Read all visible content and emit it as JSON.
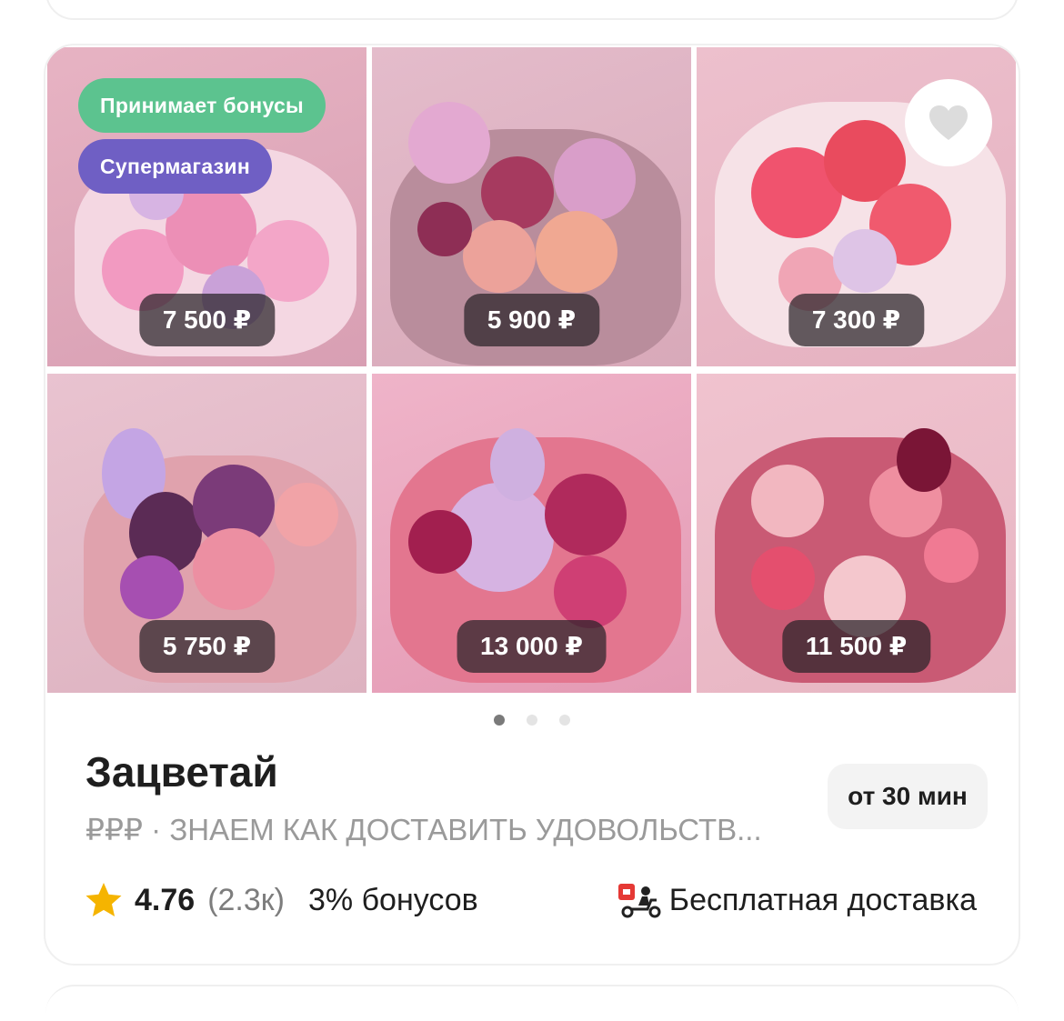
{
  "store": {
    "name": "Зацветай",
    "price_level": "₽₽₽",
    "separator": " · ",
    "tagline": "ЗНАЕМ КАК ДОСТАВИТЬ УДОВОЛЬСТВ...",
    "delivery_time": "от 30 мин",
    "rating": "4.76",
    "rating_count": "(2.3к)",
    "bonus": "3% бонусов",
    "delivery": "Бесплатная доставка"
  },
  "badges": {
    "bonuses": "Принимает бонусы",
    "super": "Супермагазин"
  },
  "products": [
    {
      "price": "7 500 ₽",
      "bg": "#e7b3c3"
    },
    {
      "price": "5 900 ₽",
      "bg": "#e4bccb"
    },
    {
      "price": "7 300 ₽",
      "bg": "#edc0cd"
    },
    {
      "price": "5 750 ₽",
      "bg": "#e9c3d0"
    },
    {
      "price": "13 000 ₽",
      "bg": "#efb4c9"
    },
    {
      "price": "11 500 ₽",
      "bg": "#f0c3cf"
    }
  ],
  "carousel": {
    "pages": 3,
    "active": 1
  },
  "icons": {
    "favorite": "heart-icon",
    "rating": "star-icon",
    "delivery": "scooter-icon"
  },
  "colors": {
    "accent_green": "#5cc38f",
    "accent_purple": "#6f5fc4",
    "star": "#f5b400"
  }
}
